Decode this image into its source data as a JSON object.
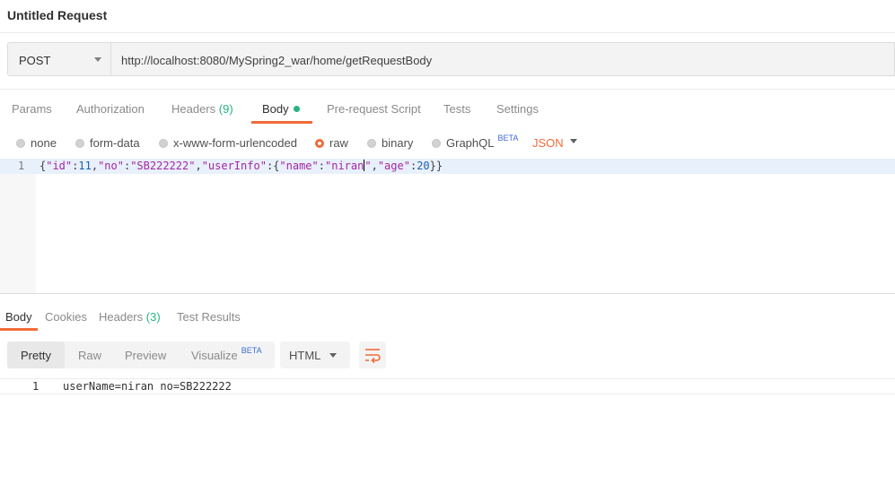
{
  "request": {
    "title": "Untitled Request"
  },
  "url_bar": {
    "method": "POST",
    "url": "http://localhost:8080/MySpring2_war/home/getRequestBody"
  },
  "request_tabs": [
    {
      "label": "Params"
    },
    {
      "label": "Authorization"
    },
    {
      "label": "Headers",
      "count": "(9)"
    },
    {
      "label": "Body"
    },
    {
      "label": "Pre-request Script"
    },
    {
      "label": "Tests"
    },
    {
      "label": "Settings"
    }
  ],
  "body_types": {
    "none": "none",
    "form_data": "form-data",
    "urlencoded": "x-www-form-urlencoded",
    "raw": "raw",
    "binary": "binary",
    "graphql": "GraphQL",
    "graphql_badge": "BETA",
    "format": "JSON"
  },
  "editor": {
    "line": "1",
    "tokens": [
      "{",
      "\"id\"",
      ":",
      "11",
      ",",
      "\"no\"",
      ":",
      "\"SB222222\"",
      ",",
      "\"userInfo\"",
      ":",
      "{",
      "\"name\"",
      ":",
      "\"niran",
      "\"",
      ",",
      "\"age\"",
      ":",
      "20",
      "}}"
    ]
  },
  "response_tabs": [
    {
      "label": "Body"
    },
    {
      "label": "Cookies"
    },
    {
      "label": "Headers",
      "count": "(3)"
    },
    {
      "label": "Test Results"
    }
  ],
  "response_view": {
    "pretty": "Pretty",
    "raw": "Raw",
    "preview": "Preview",
    "visualize": "Visualize",
    "visualize_badge": "BETA",
    "format": "HTML"
  },
  "response_body": {
    "line": "1",
    "text": "userName=niran no=SB222222"
  },
  "colors": {
    "accent": "#f26b3a",
    "count_green": "#26b47f",
    "beta_blue": "#3c6bd6"
  }
}
